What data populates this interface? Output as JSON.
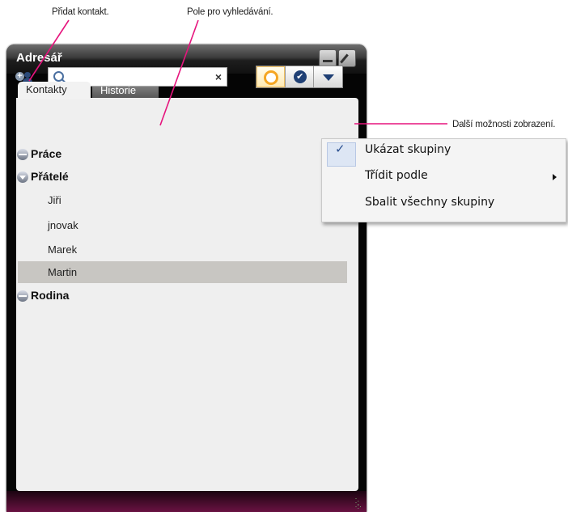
{
  "callouts": {
    "add_contact": "Přidat kontakt.",
    "search_field": "Pole pro vyhledávání.",
    "more_options": "Další možnosti zobrazení."
  },
  "window": {
    "title": "Adresář",
    "tabs": [
      {
        "label": "Kontakty",
        "active": true
      },
      {
        "label": "Historie",
        "active": false
      }
    ]
  },
  "toolbar": {
    "search_placeholder": "",
    "clear_glyph": "×",
    "view_buttons": [
      {
        "name": "online-filter",
        "icon": "ring-icon"
      },
      {
        "name": "status-filter",
        "icon": "check-badge-icon",
        "glyph": "✔"
      },
      {
        "name": "more-options",
        "icon": "chevron-down-icon"
      }
    ]
  },
  "contacts": {
    "groups": [
      {
        "label": "Práce",
        "state": "collapsed",
        "members": []
      },
      {
        "label": "Přátelé",
        "state": "expanded",
        "members": [
          "Jiři",
          "jnovak",
          "Marek",
          "Martin"
        ]
      },
      {
        "label": "Rodina",
        "state": "collapsed",
        "members": []
      }
    ],
    "selected": "Martin"
  },
  "menu": {
    "items": [
      {
        "label": "Ukázat skupiny",
        "checked": true,
        "check_glyph": "✓"
      },
      {
        "label": "Třídit podle",
        "submenu": true
      },
      {
        "label": "Sbalit všechny skupiny"
      }
    ]
  },
  "colors": {
    "accent_callout": "#e6147d",
    "window_bg": "#050505",
    "bottom_bar": "#6a1242",
    "icon_blue": "#1f3f74",
    "online_orange": "#f5a623"
  }
}
